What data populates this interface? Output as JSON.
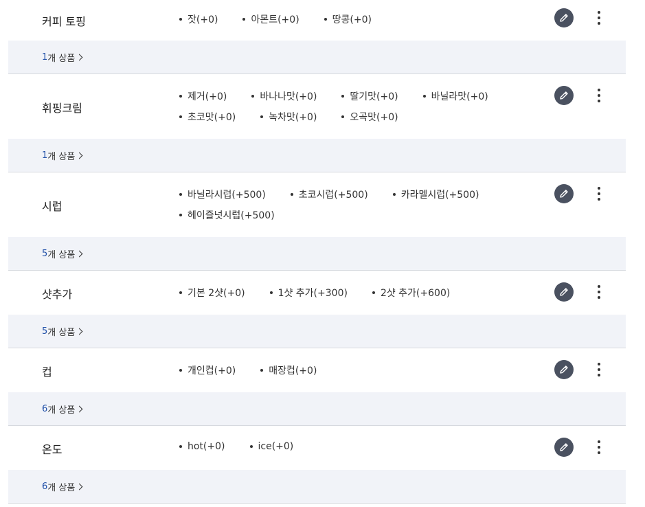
{
  "groups": [
    {
      "name": "커피 토핑",
      "options": [
        "잣(+0)",
        "아몬트(+0)",
        "땅콩(+0)"
      ],
      "count": "1",
      "count_suffix": "개 상품"
    },
    {
      "name": "휘핑크림",
      "options": [
        "제거(+0)",
        "바나나맛(+0)",
        "딸기맛(+0)",
        "바닐라맛(+0)",
        "초코맛(+0)",
        "녹차맛(+0)",
        "오곡맛(+0)"
      ],
      "count": "1",
      "count_suffix": "개 상품"
    },
    {
      "name": "시럽",
      "options": [
        "바닐라시럽(+500)",
        "초코시럽(+500)",
        "카라멜시럽(+500)",
        "헤이즐넛시럽(+500)"
      ],
      "count": "5",
      "count_suffix": "개 상품"
    },
    {
      "name": "샷추가",
      "options": [
        "기본 2샷(+0)",
        "1샷 추가(+300)",
        "2샷 추가(+600)"
      ],
      "count": "5",
      "count_suffix": "개 상품"
    },
    {
      "name": "컵",
      "options": [
        "개인컵(+0)",
        "매장컵(+0)"
      ],
      "count": "6",
      "count_suffix": "개 상품"
    },
    {
      "name": "온도",
      "options": [
        "hot(+0)",
        "ice(+0)"
      ],
      "count": "6",
      "count_suffix": "개 상품"
    }
  ],
  "icons": {
    "edit": "pencil-icon",
    "more": "more-vertical-icon",
    "chevron": "chevron-right-icon"
  },
  "colors": {
    "edit_button_bg": "#4a5160",
    "count_number": "#1f4fa8",
    "sub_row_bg": "#f1f3f8"
  }
}
